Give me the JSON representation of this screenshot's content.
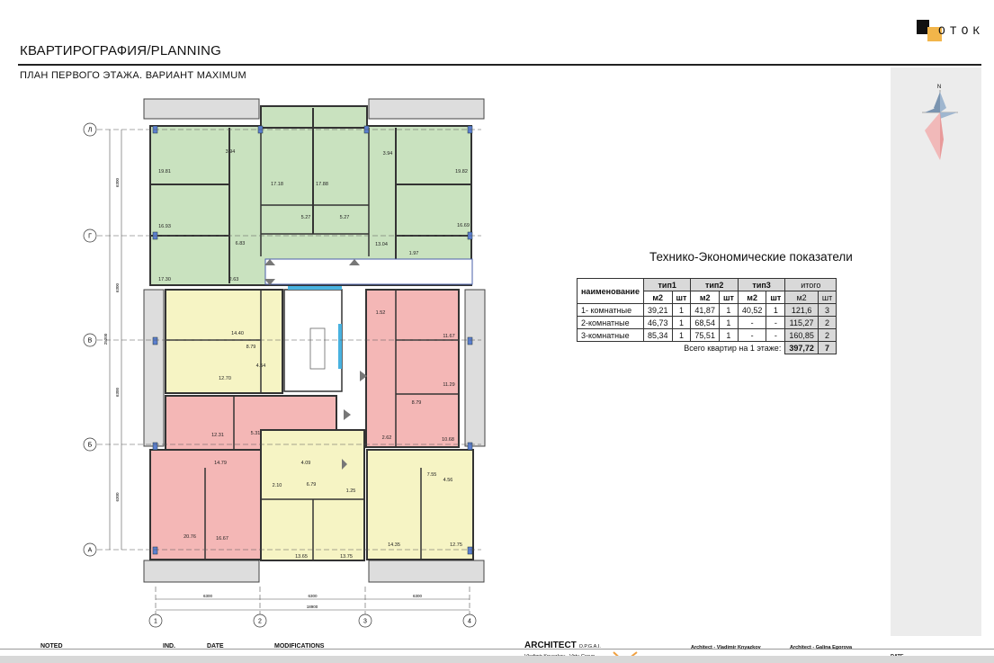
{
  "header": {
    "title": "КВАРТИРОГРАФИЯ/PLANNING",
    "subtitle": "ПЛАН ПЕРВОГО ЭТАЖА. ВАРИАНТ MAXIMUM",
    "logo_text": "ОТОК"
  },
  "compass": {
    "north_label": "N"
  },
  "tep": {
    "title": "Технико-Экономические показатели",
    "col_name": "наименование",
    "groups": [
      "тип1",
      "тип2",
      "тип3",
      "итого"
    ],
    "sub": [
      "м2",
      "шт"
    ],
    "rows": [
      [
        "1- комнатные",
        "39,21",
        "1",
        "41,87",
        "1",
        "40,52",
        "1",
        "121,6",
        "3"
      ],
      [
        "2-комнатные",
        "46,73",
        "1",
        "68,54",
        "1",
        "-",
        "-",
        "115,27",
        "2"
      ],
      [
        "3-комнатные",
        "85,34",
        "1",
        "75,51",
        "1",
        "-",
        "-",
        "160,85",
        "2"
      ]
    ],
    "total_label": "Всего квартир на  1 этаже:",
    "total_area": "397,72",
    "total_count": "7"
  },
  "plan": {
    "axes_rows": [
      "Л",
      "Г",
      "В",
      "Б",
      "А"
    ],
    "axes_cols": [
      "1",
      "2",
      "3",
      "4"
    ],
    "dims_left": [
      "6300",
      "6300",
      "6300",
      "6300"
    ],
    "dims_left_total": "25200",
    "dims_bottom": [
      "6300",
      "6300",
      "6300"
    ],
    "dims_bottom_total": "18900",
    "room_labels": [
      "19.81",
      "3.94",
      "17.18",
      "17.88",
      "3.94",
      "19.82",
      "5.27",
      "5.27",
      "13.04",
      "16.69",
      "16.93",
      "6.83",
      "17.30",
      "2.63",
      "1.97",
      "14.40",
      "8.79",
      "4.54",
      "12.70",
      "11.67",
      "1.52",
      "11.29",
      "8.79",
      "12.31",
      "5.31",
      "14.79",
      "4.09",
      "6.79",
      "2.10",
      "1.25",
      "7.55",
      "4.56",
      "2.62",
      "10.68",
      "20.76",
      "16.67",
      "13.65",
      "13.75",
      "14.35",
      "12.75"
    ]
  },
  "footer": {
    "noted": "NOTED",
    "ind": "IND.",
    "date": "DATE",
    "modifications": "MODIFICATIONS",
    "architect": "ARCHITECT",
    "architect_sub": "O.P.G.A.I.",
    "architect_names": "Vladimir Knyazkov - Virtu Group -",
    "architect1": "Architect - Vladimir Knyazkov",
    "architect2": "Architect - Galina Egorova",
    "date2": "DATE"
  },
  "colors": {
    "green": "#c9e2bf",
    "yellow": "#f6f4c4",
    "pink": "#f4b7b6",
    "gray_balcony": "#b8b8b8"
  }
}
